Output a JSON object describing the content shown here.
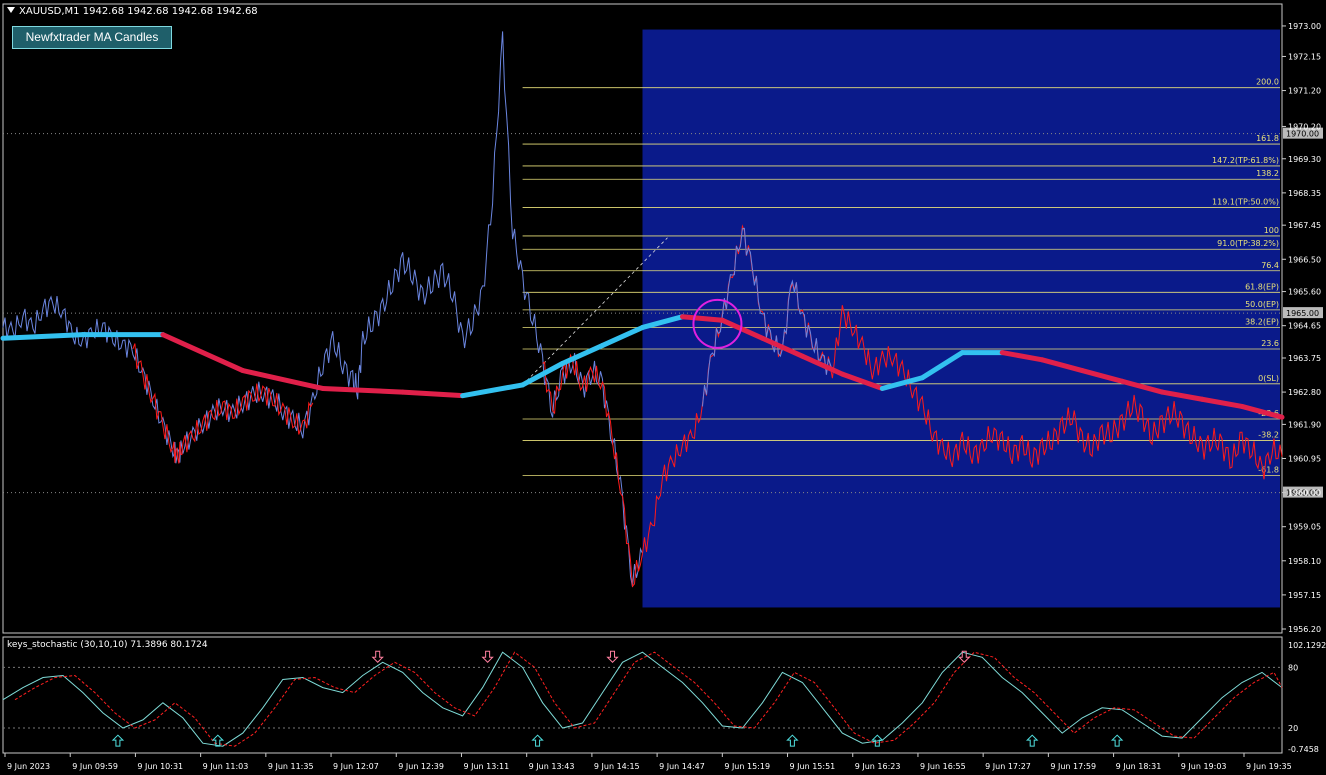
{
  "header": {
    "symbol_line": "XAUUSD,M1  1942.68 1942.68 1942.68 1942.68"
  },
  "button": {
    "label": "Newfxtrader MA Candles"
  },
  "indicator": {
    "title": "keys_stochastic (30,10,10) 71.3896 80.1724"
  },
  "colors": {
    "bull": "#6b86e0",
    "bear": "#ff1a1a",
    "ma_up": "#33c1f0",
    "ma_down": "#e0204a",
    "fib": "#e8e07a",
    "box": "#0a1a8a",
    "stoch_main": "#7fdcd8",
    "stoch_signal": "#ff2020",
    "circle": "#e020e0",
    "arrow_up": "#50e0e0",
    "arrow_down": "#ff80a0"
  },
  "chart_data": [
    {
      "type": "line",
      "series": [
        {
          "x": [
            0,
            10,
            20,
            30,
            40,
            50,
            60,
            70,
            80,
            90,
            100,
            110,
            120,
            130,
            140,
            150,
            160,
            170,
            175,
            180,
            190,
            200,
            210,
            220,
            230,
            240,
            250,
            260,
            270,
            280,
            290,
            300,
            310,
            320,
            330,
            340,
            350,
            355,
            360,
            370,
            380,
            390,
            400,
            410,
            420,
            430,
            440,
            450,
            460,
            470,
            480,
            490,
            500,
            510,
            520,
            530,
            540,
            550,
            560,
            570,
            580,
            590,
            600,
            610,
            620,
            630,
            640
          ],
          "values": [
            1964.6,
            1964.5,
            1964.9,
            1964.6,
            1965.1,
            1965.3,
            1965.0,
            1964.4,
            1964.2,
            1964.5,
            1964.6,
            1964.3,
            1964.1,
            1964.0,
            1963.3,
            1962.6,
            1961.9,
            1961.2,
            1961.0,
            1961.3,
            1961.6,
            1961.9,
            1962.2,
            1962.4,
            1962.2,
            1962.5,
            1962.7,
            1962.8,
            1962.6,
            1962.3,
            1962.0,
            1961.8,
            1962.5,
            1963.6,
            1964.2,
            1963.6,
            1963.1,
            1962.9,
            1964.2,
            1964.8,
            1965.1,
            1965.9,
            1966.4,
            1966.1,
            1965.4,
            1965.9,
            1966.1,
            1965.6,
            1964.2,
            1964.8,
            1965.5,
            1968.3,
            1972.6,
            1967.3,
            1965.9,
            1964.9,
            1963.6,
            1962.3,
            1963.3,
            1963.7,
            1962.9,
            1963.4,
            1963.0,
            1961.5,
            1959.8,
            1957.5,
            1958.3
          ]
        },
        {
          "x": [
            640,
            650,
            660,
            670,
            680,
            690,
            700,
            710,
            720,
            730,
            740,
            750,
            760,
            770,
            780,
            790,
            800,
            810,
            820,
            830,
            840,
            850,
            860,
            870,
            880,
            890,
            900,
            910,
            920,
            930,
            940,
            950,
            960,
            970,
            980,
            990,
            1000,
            1010,
            1020,
            1030,
            1040,
            1050,
            1060,
            1070,
            1080,
            1090,
            1100,
            1110,
            1120,
            1130,
            1140,
            1150,
            1160,
            1170,
            1180,
            1190,
            1200,
            1210,
            1220,
            1230,
            1240,
            1250,
            1260,
            1270,
            1280
          ],
          "values": [
            1958.3,
            1959.1,
            1960.4,
            1960.9,
            1961.3,
            1961.6,
            1962.4,
            1963.9,
            1964.9,
            1966.1,
            1967.3,
            1966.3,
            1964.9,
            1964.2,
            1963.9,
            1966.0,
            1964.9,
            1964.2,
            1963.7,
            1963.4,
            1965.0,
            1964.6,
            1964.1,
            1963.4,
            1963.7,
            1963.8,
            1963.4,
            1962.9,
            1962.4,
            1961.7,
            1961.2,
            1961.0,
            1961.4,
            1961.1,
            1961.2,
            1961.7,
            1961.4,
            1961.1,
            1961.3,
            1961.0,
            1961.2,
            1961.5,
            1961.8,
            1962.2,
            1961.4,
            1961.3,
            1961.6,
            1961.7,
            1961.9,
            1962.5,
            1962.1,
            1961.6,
            1961.9,
            1962.3,
            1961.9,
            1961.6,
            1961.2,
            1961.5,
            1961.3,
            1960.9,
            1961.5,
            1961.2,
            1960.6,
            1961.2,
            1961.0
          ]
        }
      ],
      "ma": {
        "x": [
          0,
          80,
          160,
          240,
          320,
          400,
          460,
          520,
          560,
          600,
          640,
          680,
          720,
          760,
          800,
          840,
          880,
          920,
          960,
          1000,
          1040,
          1080,
          1120,
          1160,
          1200,
          1240,
          1280
        ],
        "values": [
          1964.3,
          1964.4,
          1964.4,
          1963.4,
          1962.9,
          1962.8,
          1962.7,
          1963.0,
          1963.6,
          1964.1,
          1964.6,
          1964.9,
          1964.8,
          1964.3,
          1963.8,
          1963.3,
          1962.9,
          1963.2,
          1963.9,
          1963.9,
          1963.7,
          1963.4,
          1963.1,
          1962.8,
          1962.6,
          1962.4,
          1962.1
        ]
      },
      "ylim": [
        1956.2,
        1973.5
      ],
      "y_ticks": [
        "1973.00",
        "1972.15",
        "1971.20",
        "1970.20",
        "1969.30",
        "1968.35",
        "1967.45",
        "1966.50",
        "1965.60",
        "1964.65",
        "1963.75",
        "1962.80",
        "1961.90",
        "1960.95",
        "1960.00",
        "1959.05",
        "1958.10",
        "1957.15",
        "1956.20"
      ],
      "price_labels": [
        "1970.00",
        "1965.00",
        "1960.00"
      ],
      "fib_levels": [
        {
          "label": "200.0",
          "value": 1971.28
        },
        {
          "label": "161.8",
          "value": 1969.71
        },
        {
          "label": "147.2(TP:61.8%)",
          "value": 1969.1
        },
        {
          "label": "138.2",
          "value": 1968.73
        },
        {
          "label": "119.1(TP:50.0%)",
          "value": 1967.94
        },
        {
          "label": "100",
          "value": 1967.15
        },
        {
          "label": "91.0(TP:38.2%)",
          "value": 1966.78
        },
        {
          "label": "76.4",
          "value": 1966.18
        },
        {
          "label": "61.8(EP)",
          "value": 1965.58
        },
        {
          "label": "50.0(EP)",
          "value": 1965.09
        },
        {
          "label": "38.2(EP)",
          "value": 1964.6
        },
        {
          "label": "23.6",
          "value": 1964.0
        },
        {
          "label": "0(SL)",
          "value": 1963.03
        },
        {
          "label": "-23.6",
          "value": 1962.05
        },
        {
          "label": "-38.2",
          "value": 1961.45
        },
        {
          "label": "-61.8",
          "value": 1960.48
        }
      ]
    },
    {
      "type": "line",
      "series": [
        {
          "x": [
            0,
            20,
            40,
            60,
            80,
            100,
            120,
            140,
            160,
            180,
            200,
            220,
            240,
            260,
            280,
            300,
            320,
            340,
            360,
            380,
            400,
            420,
            440,
            460,
            480,
            500,
            520,
            540,
            560,
            580,
            600,
            620,
            640,
            660,
            680,
            700,
            720,
            740,
            760,
            780,
            800,
            820,
            840,
            860,
            880,
            900,
            920,
            940,
            960,
            980,
            1000,
            1020,
            1040,
            1060,
            1080,
            1100,
            1120,
            1140,
            1160,
            1180,
            1200,
            1220,
            1240,
            1260,
            1280
          ],
          "values": [
            48,
            60,
            70,
            72,
            55,
            35,
            20,
            28,
            45,
            30,
            5,
            2,
            15,
            40,
            68,
            70,
            60,
            55,
            72,
            85,
            75,
            55,
            40,
            32,
            60,
            95,
            80,
            45,
            20,
            25,
            55,
            85,
            95,
            80,
            65,
            45,
            22,
            20,
            45,
            75,
            65,
            40,
            15,
            5,
            8,
            25,
            45,
            75,
            95,
            90,
            70,
            55,
            35,
            15,
            30,
            40,
            38,
            25,
            12,
            10,
            30,
            50,
            65,
            75,
            60
          ]
        }
      ],
      "ylim": [
        -0.7458,
        102.1292
      ],
      "y_ticks": [
        "102.1292",
        "80",
        "20",
        "-0.7458"
      ]
    }
  ],
  "x_axis": {
    "labels": [
      "9 Jun 2023",
      "9 Jun 09:59",
      "9 Jun 10:31",
      "9 Jun 11:03",
      "9 Jun 11:35",
      "9 Jun 12:07",
      "9 Jun 12:39",
      "9 Jun 13:11",
      "9 Jun 13:43",
      "9 Jun 14:15",
      "9 Jun 14:47",
      "9 Jun 15:19",
      "9 Jun 15:51",
      "9 Jun 16:23",
      "9 Jun 16:55",
      "9 Jun 17:27",
      "9 Jun 17:59",
      "9 Jun 18:31",
      "9 Jun 19:03",
      "9 Jun 19:35"
    ]
  }
}
